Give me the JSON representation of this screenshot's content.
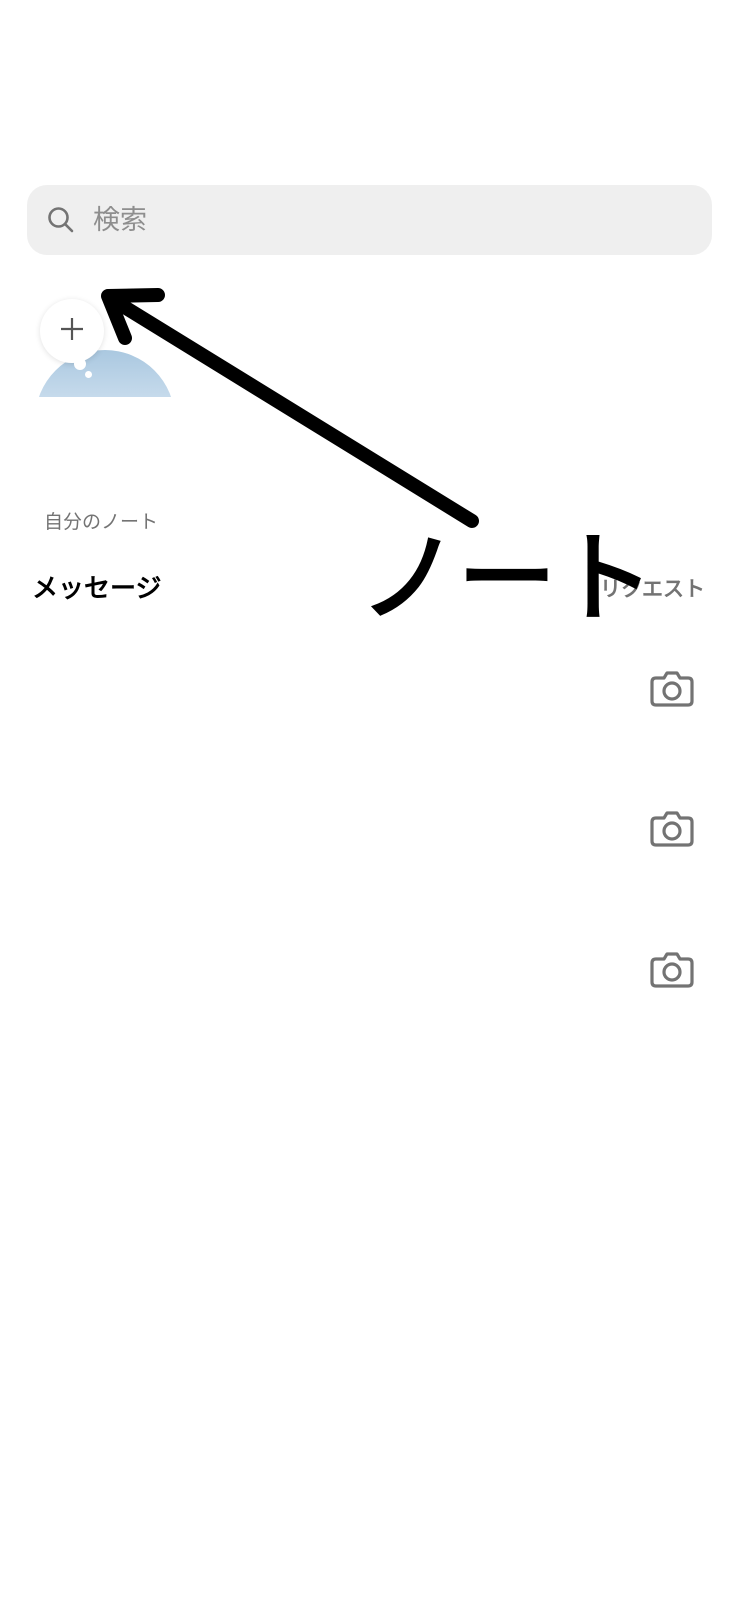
{
  "search": {
    "placeholder": "検索",
    "icon": "search-icon"
  },
  "notes": {
    "add_icon": "plus-icon",
    "my_note_label": "自分のノート"
  },
  "messages": {
    "title": "メッセージ",
    "requests_label": "リクエスト"
  },
  "threads": [
    {
      "camera_icon": "camera-icon"
    },
    {
      "camera_icon": "camera-icon"
    },
    {
      "camera_icon": "camera-icon"
    }
  ],
  "annotation": {
    "label": "ノート"
  },
  "colors": {
    "search_bg": "#efefef",
    "muted_text": "#737373",
    "placeholder_text": "#8e8e8e",
    "annotation": "#000000"
  }
}
